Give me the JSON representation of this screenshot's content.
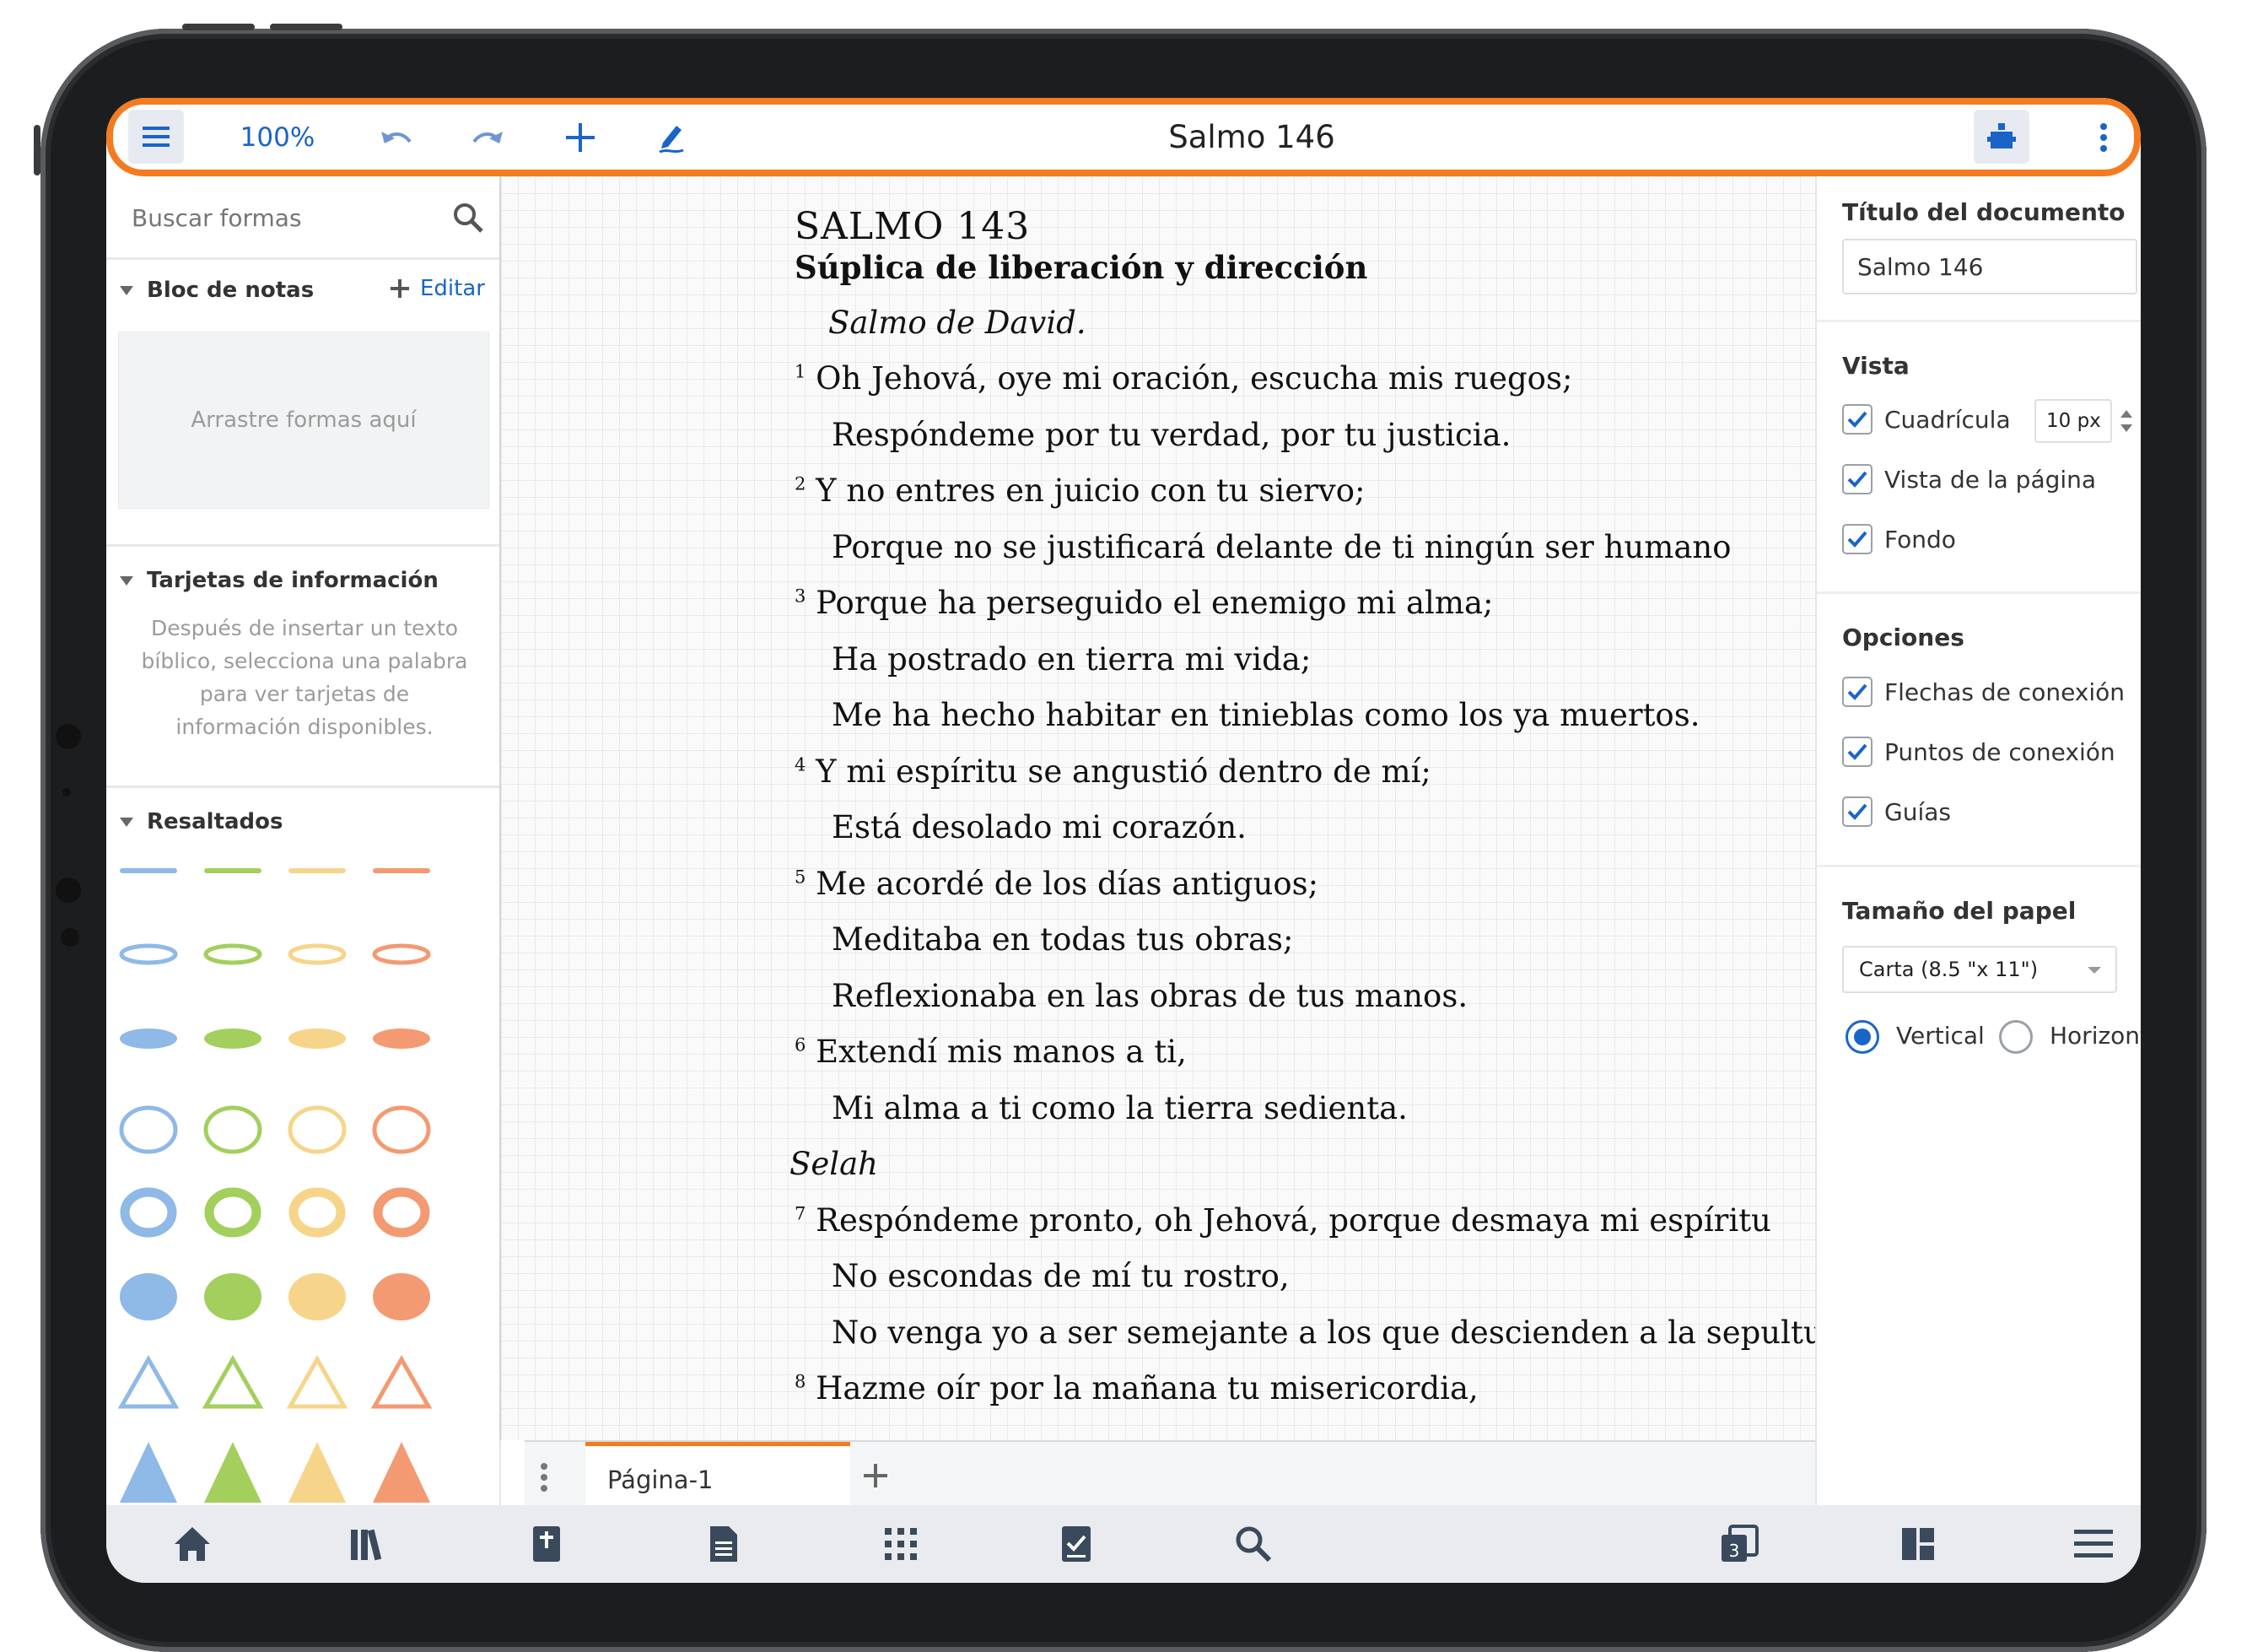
{
  "toolbar": {
    "zoom": "100%",
    "document_title": "Salmo 146"
  },
  "left_panel": {
    "search_placeholder": "Buscar formas",
    "notes_header": "Bloc de notas",
    "edit_label": "Editar",
    "drop_zone_text": "Arrastre formas aquí",
    "info_cards_header": "Tarjetas de información",
    "info_cards_text": "Después de insertar un texto bíblico, selecciona una palabra para ver tarjetas de información disponibles.",
    "highlights_header": "Resaltados",
    "highlight_colors": [
      "#8fb9e6",
      "#a3cf5c",
      "#f6d58a",
      "#f39a72"
    ]
  },
  "document": {
    "title": "SALMO 143",
    "subtitle": "Súplica de liberación y dirección",
    "attribution": "Salmo de David.",
    "lines": [
      {
        "verse": "1",
        "text": "Oh Jehová, oye mi oración, escucha mis ruegos;"
      },
      {
        "verse": "",
        "text": "Respóndeme por tu verdad, por tu justicia."
      },
      {
        "verse": "2",
        "text": "Y no entres en juicio con tu siervo;"
      },
      {
        "verse": "",
        "text": "Porque no se justificará delante de ti ningún ser humano"
      },
      {
        "verse": "3",
        "text": "Porque ha perseguido el enemigo mi alma;"
      },
      {
        "verse": "",
        "text": "Ha postrado en tierra mi vida;"
      },
      {
        "verse": "",
        "text": "Me ha hecho habitar en tinieblas como los ya muertos."
      },
      {
        "verse": "4",
        "text": "Y mi espíritu se angustió dentro de mí;"
      },
      {
        "verse": "",
        "text": "Está desolado mi corazón."
      },
      {
        "verse": "5",
        "text": "Me acordé de los días antiguos;"
      },
      {
        "verse": "",
        "text": "Meditaba en todas tus obras;"
      },
      {
        "verse": "",
        "text": "Reflexionaba en las obras de tus manos."
      },
      {
        "verse": "6",
        "text": "Extendí mis manos a ti,"
      },
      {
        "verse": "",
        "text": "Mi alma a ti como la tierra sedienta."
      },
      {
        "verse": "",
        "text": "Selah"
      },
      {
        "verse": "7",
        "text": "Respóndeme pronto, oh Jehová, porque desmaya mi espíritu"
      },
      {
        "verse": "",
        "text": "No escondas de mí tu rostro,"
      },
      {
        "verse": "",
        "text": "No venga yo a ser semejante a los que descienden a la sepultura."
      },
      {
        "verse": "8",
        "text": "Hazme oír por la mañana tu misericordia,"
      }
    ]
  },
  "page_bar": {
    "tab_label": "Página-1"
  },
  "right_panel": {
    "doc_title_header": "Título del documento",
    "doc_title_value": "Salmo 146",
    "view_header": "Vista",
    "grid_label": "Cuadrícula",
    "grid_size": "10 px",
    "page_view_label": "Vista de la página",
    "background_label": "Fondo",
    "options_header": "Opciones",
    "connection_arrows_label": "Flechas de conexión",
    "connection_points_label": "Puntos de conexión",
    "guides_label": "Guías",
    "paper_size_header": "Tamaño del papel",
    "paper_size_value": "Carta (8.5 \"x 11\")",
    "orientation_vertical": "Vertical",
    "orientation_horizontal": "Horizontal",
    "orientation_selected": "Vertical",
    "grid_checked": true,
    "page_view_checked": true,
    "background_checked": true,
    "arrows_checked": true,
    "points_checked": true,
    "guides_checked": true
  },
  "bottom_nav": {
    "tabs": [
      "home-icon",
      "library-icon",
      "bible-icon",
      "document-icon",
      "apps-icon",
      "tasks-icon",
      "search-icon",
      "panels-icon",
      "layout-icon",
      "menu-icon"
    ],
    "panels_badge": "3"
  },
  "colors": {
    "accent": "#f47b20",
    "link": "#1a64c8"
  }
}
